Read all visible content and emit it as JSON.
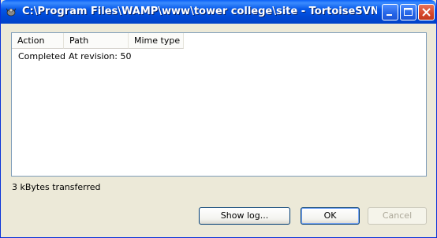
{
  "window": {
    "title": "C:\\Program Files\\WAMP\\www\\tower college\\site - TortoiseSVN Update...."
  },
  "list": {
    "columns": [
      "Action",
      "Path",
      "Mime type"
    ],
    "rows": [
      {
        "action": "Completed",
        "path": "At revision: 50",
        "mime": ""
      }
    ]
  },
  "status": {
    "text": "3 kBytes transferred"
  },
  "buttons": {
    "show_log": "Show log...",
    "ok": "OK",
    "cancel": "Cancel"
  }
}
